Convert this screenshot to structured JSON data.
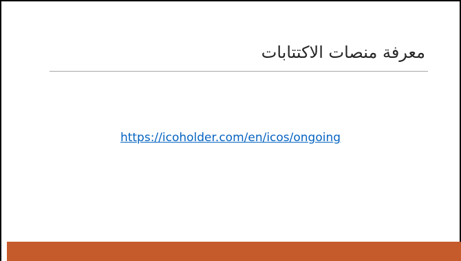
{
  "slide": {
    "title": "معرفة منصات الاكتتابات",
    "link_text": "https://icoholder.com/en/icos/ongoing"
  },
  "colors": {
    "accent_bar": "#c55a2b",
    "link": "#0563c1",
    "title_text": "#262626",
    "divider": "#a6a6a6"
  }
}
